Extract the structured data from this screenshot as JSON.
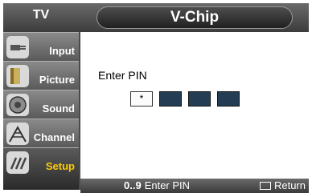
{
  "app": {
    "source_label": "TV",
    "title": "V-Chip"
  },
  "sidebar": {
    "items": [
      {
        "label": "Input",
        "icon": "input-plug-icon"
      },
      {
        "label": "Picture",
        "icon": "picture-icon"
      },
      {
        "label": "Sound",
        "icon": "speaker-icon"
      },
      {
        "label": "Channel",
        "icon": "antenna-icon"
      },
      {
        "label": "Setup",
        "icon": "setup-icon",
        "active": true
      }
    ]
  },
  "main": {
    "prompt": "Enter PIN",
    "pin": {
      "digits_total": 4,
      "digits_entered": 1,
      "mask": "*"
    }
  },
  "footer": {
    "hint_keys": "0..9",
    "hint_text": "Enter PIN",
    "return_label": "Return"
  },
  "colors": {
    "frame": "#4a4a4a",
    "active_label": "#ffcc00",
    "pin_box": "#243c54"
  }
}
